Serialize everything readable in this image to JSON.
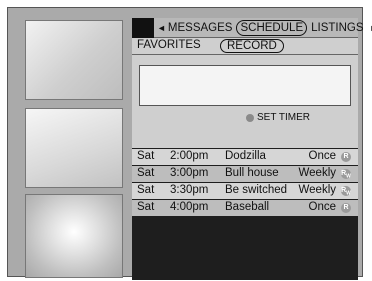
{
  "tabs": {
    "left_arrow": "◄",
    "messages": "MESSAGES",
    "schedule": "SCHEDULE",
    "listings": "LISTINGS",
    "right_arrow": "►"
  },
  "subtabs": {
    "favorites": "FAVORITES",
    "record": "RECORD"
  },
  "set_timer": "SET TIMER",
  "schedule": [
    {
      "day": "Sat",
      "time": "2:00pm",
      "title": "Dodzilla",
      "freq": "Once",
      "badge": "R",
      "badge_sub": ""
    },
    {
      "day": "Sat",
      "time": "3:00pm",
      "title": "Bull house",
      "freq": "Weekly",
      "badge": "R",
      "badge_sub": "W"
    },
    {
      "day": "Sat",
      "time": "3:30pm",
      "title": "Be switched",
      "freq": "Weekly",
      "badge": "R",
      "badge_sub": "W"
    },
    {
      "day": "Sat",
      "time": "4:00pm",
      "title": "Baseball",
      "freq": "Once",
      "badge": "R",
      "badge_sub": ""
    }
  ]
}
